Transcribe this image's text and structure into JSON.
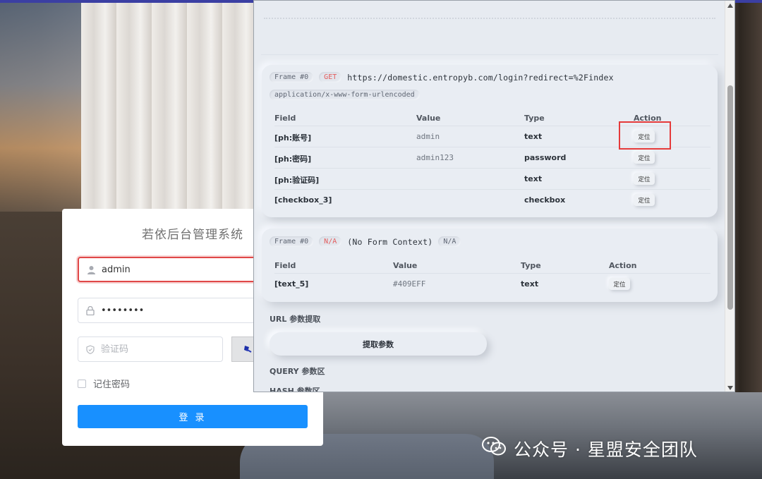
{
  "login": {
    "title": "若依后台管理系统",
    "username_value": "admin",
    "password_value": "••••••••",
    "captcha_placeholder": "验证码",
    "remember_label": "记住密码",
    "login_button": "登 录"
  },
  "panel": {
    "form1": {
      "frame_label": "Frame #0",
      "method": "GET",
      "url": "https://domestic.entropyb.com/login?redirect=%2Findex",
      "enctype": "application/x-www-form-urlencoded",
      "headers": {
        "field": "Field",
        "value": "Value",
        "type": "Type",
        "action": "Action"
      },
      "rows": [
        {
          "field": "[ph:账号]",
          "value": "admin",
          "type": "text",
          "action": "定位"
        },
        {
          "field": "[ph:密码]",
          "value": "admin123",
          "type": "password",
          "action": "定位"
        },
        {
          "field": "[ph:验证码]",
          "value": "",
          "type": "text",
          "action": "定位"
        },
        {
          "field": "[checkbox_3]",
          "value": "",
          "type": "checkbox",
          "action": "定位"
        }
      ]
    },
    "form2": {
      "frame_label": "Frame #0",
      "method": "N/A",
      "context": "(No Form Context)",
      "enctype": "N/A",
      "headers": {
        "field": "Field",
        "value": "Value",
        "type": "Type",
        "action": "Action"
      },
      "rows": [
        {
          "field": "[text_5]",
          "value": "#409EFF",
          "type": "text",
          "action": "定位"
        }
      ]
    },
    "url_param_label": "URL 参数提取",
    "extract_button": "提取参数",
    "query_label": "QUERY 参数区",
    "hash_label": "HASH 参数区"
  },
  "watermark": {
    "text": "公众号 · 星盟安全团队"
  },
  "colors": {
    "accent": "#1890ff",
    "highlight": "#e53a3a",
    "method_red": "#e25c5c"
  }
}
